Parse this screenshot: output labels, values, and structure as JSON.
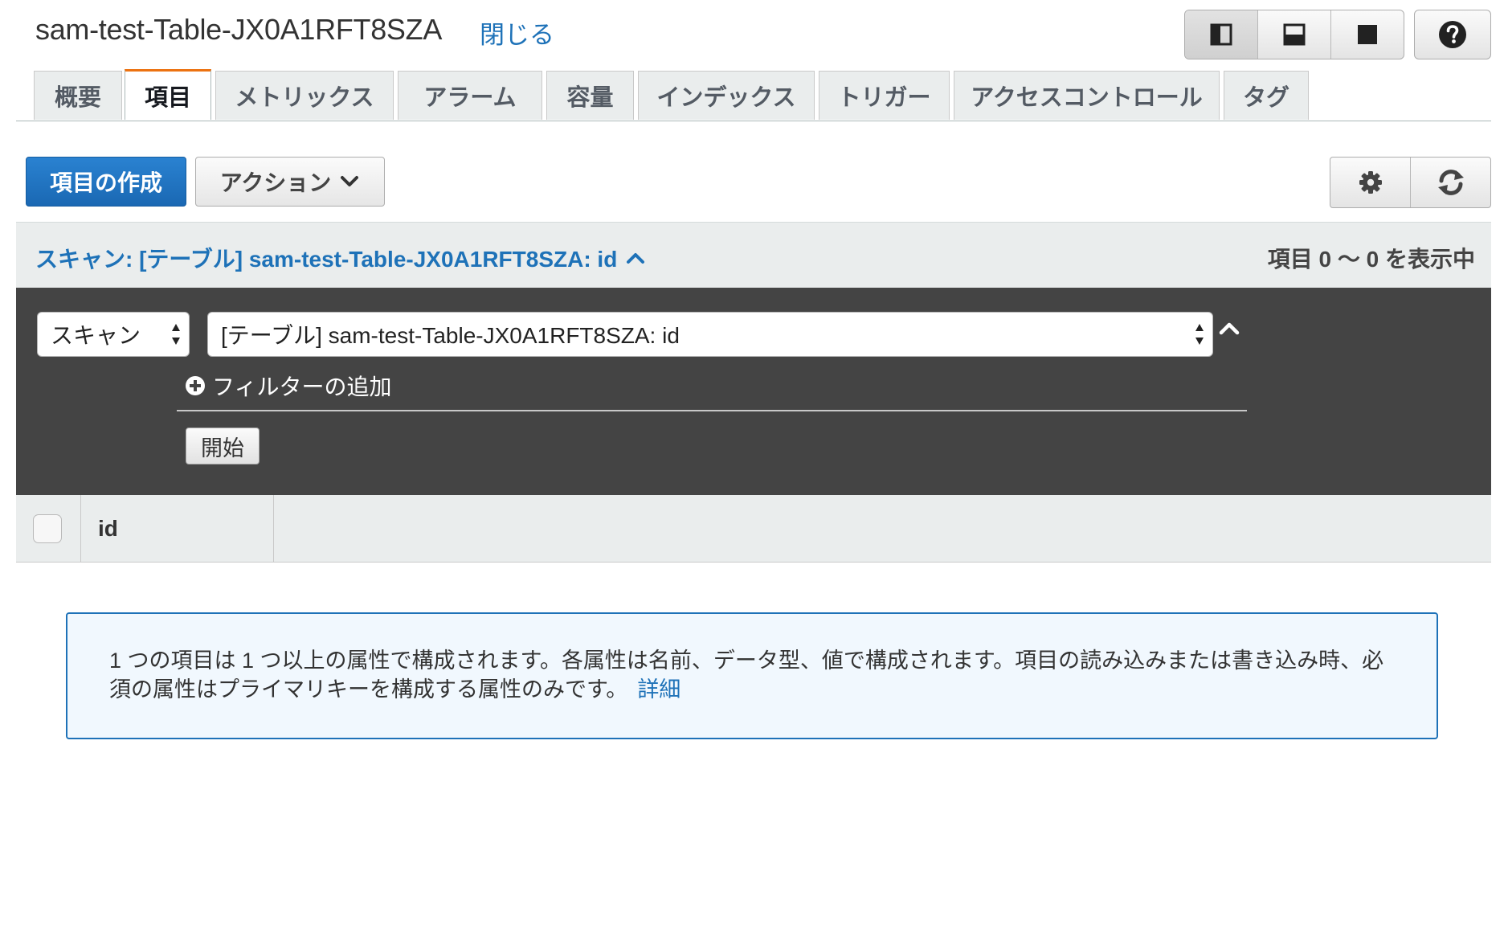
{
  "header": {
    "table_name": "sam-test-Table-JX0A1RFT8SZA",
    "close_label": "閉じる"
  },
  "layout_buttons": [
    {
      "icon": "split-vertical-icon"
    },
    {
      "icon": "split-horizontal-icon"
    },
    {
      "icon": "fullscreen-icon"
    }
  ],
  "help": {
    "icon": "help-icon"
  },
  "tabs": [
    {
      "label": "概要"
    },
    {
      "label": "項目"
    },
    {
      "label": "メトリックス"
    },
    {
      "label": "アラーム"
    },
    {
      "label": "容量"
    },
    {
      "label": "インデックス"
    },
    {
      "label": "トリガー"
    },
    {
      "label": "アクセスコントロール"
    },
    {
      "label": "タグ"
    }
  ],
  "active_tab": "項目",
  "toolbar": {
    "create_label": "項目の作成",
    "actions_label": "アクション",
    "settings_icon": "gear-icon",
    "refresh_icon": "refresh-icon"
  },
  "scan": {
    "summary": "スキャン: [テーブル] sam-test-Table-JX0A1RFT8SZA: id",
    "count_label": "項目 0 〜 0 を表示中",
    "mode_value": "スキャン",
    "target_value": "[テーブル] sam-test-Table-JX0A1RFT8SZA: id",
    "add_filter_label": "フィルターの追加",
    "start_label": "開始"
  },
  "results": {
    "columns": [
      "id"
    ]
  },
  "info": {
    "text": "1 つの項目は 1 つ以上の属性で構成されます。各属性は名前、データ型、値で構成されます。項目の読み込みまたは書き込み時、必須の属性はプライマリキーを構成する属性のみです。",
    "link_label": "詳細"
  },
  "colors": {
    "primary": "#1e72b8",
    "active_tab_accent": "#ec7211",
    "panel_dark": "#444444",
    "info_bg": "#f1f8fe"
  }
}
